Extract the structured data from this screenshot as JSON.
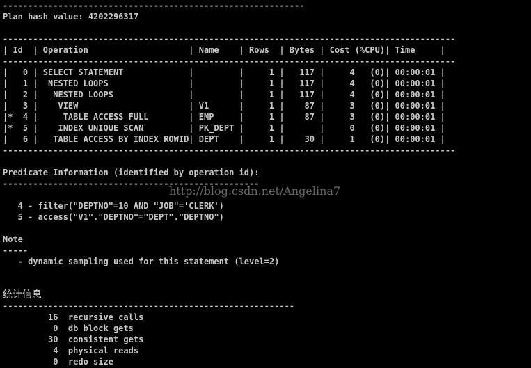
{
  "console": {
    "lines": [
      "------------------------------------------------------------",
      "Plan hash value: 4202296317",
      "",
      "------------------------------------------------------------------------------------------",
      "| Id  | Operation                    | Name    | Rows  | Bytes | Cost (%CPU)| Time     |",
      "------------------------------------------------------------------------------------------",
      "|   0 | SELECT STATEMENT             |         |     1 |   117 |     4   (0)| 00:00:01 |",
      "|   1 |  NESTED LOOPS                |         |     1 |   117 |     4   (0)| 00:00:01 |",
      "|   2 |   NESTED LOOPS               |         |     1 |   117 |     4   (0)| 00:00:01 |",
      "|   3 |    VIEW                      | V1      |     1 |    87 |     3   (0)| 00:00:01 |",
      "|*  4 |     TABLE ACCESS FULL        | EMP     |     1 |    87 |     3   (0)| 00:00:01 |",
      "|*  5 |    INDEX UNIQUE SCAN         | PK_DEPT |     1 |       |     0   (0)| 00:00:01 |",
      "|   6 |   TABLE ACCESS BY INDEX ROWID| DEPT    |     1 |    30 |     1   (0)| 00:00:01 |",
      "------------------------------------------------------------------------------------------",
      "",
      "Predicate Information (identified by operation id):",
      "---------------------------------------------------",
      "",
      "   4 - filter(\"DEPTNO\"=10 AND \"JOB\"='CLERK')",
      "   5 - access(\"V1\".\"DEPTNO\"=\"DEPT\".\"DEPTNO\")",
      "",
      "Note",
      "-----",
      "   - dynamic sampling used for this statement (level=2)",
      "",
      "",
      "统计信息",
      "----------------------------------------------------------",
      "         16  recursive calls",
      "          0  db block gets",
      "         30  consistent gets",
      "          4  physical reads",
      "          0  redo size"
    ]
  },
  "watermark": "http://blog.csdn.net/Angelina7"
}
